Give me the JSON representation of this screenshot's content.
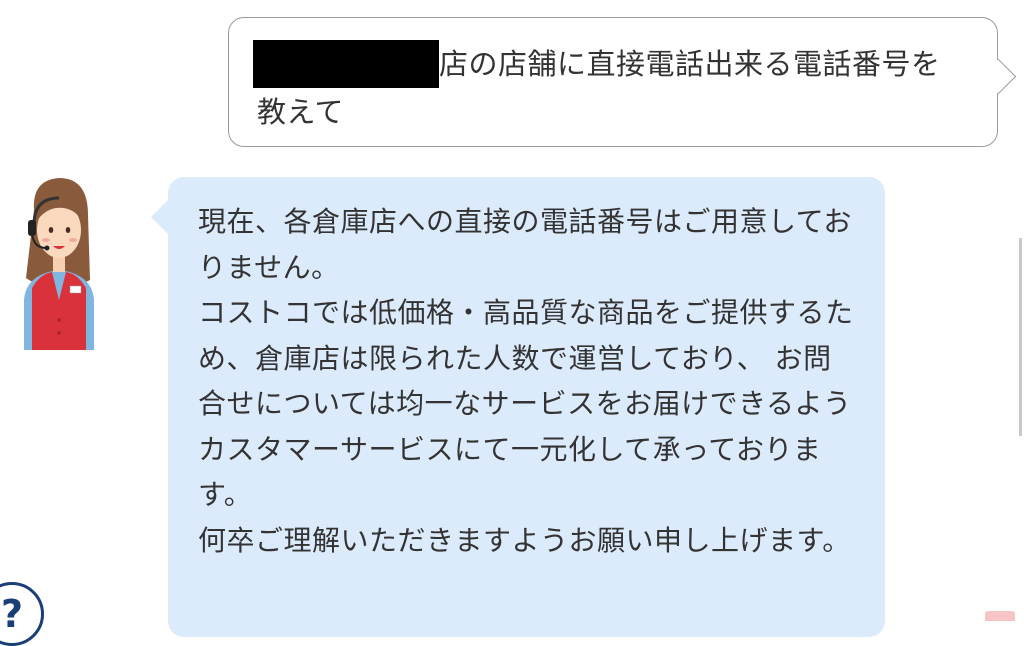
{
  "user_message": {
    "line1_text": "店の店舗に直接電話出来る電話番号を",
    "line2_text": "教えて"
  },
  "bot_message": {
    "paragraphs": [
      "現在、各倉庫店への直接の電話番号はご用意しておりません。",
      "コストコでは低価格・高品質な商品をご提供するため、倉庫店は限られた人数で運営しており、 お問合せについては均一なサービスをお届けできるようカスタマーサービスにて一元化して承っております。",
      "何卒ご理解いただきますようお願い申し上げます。"
    ]
  },
  "help_button": {
    "label": "?"
  },
  "icons": {
    "avatar": "support-agent-avatar-icon",
    "help": "question-mark-icon"
  },
  "colors": {
    "bot_bubble": "#dcebfb",
    "help_accent": "#1a3f78"
  }
}
